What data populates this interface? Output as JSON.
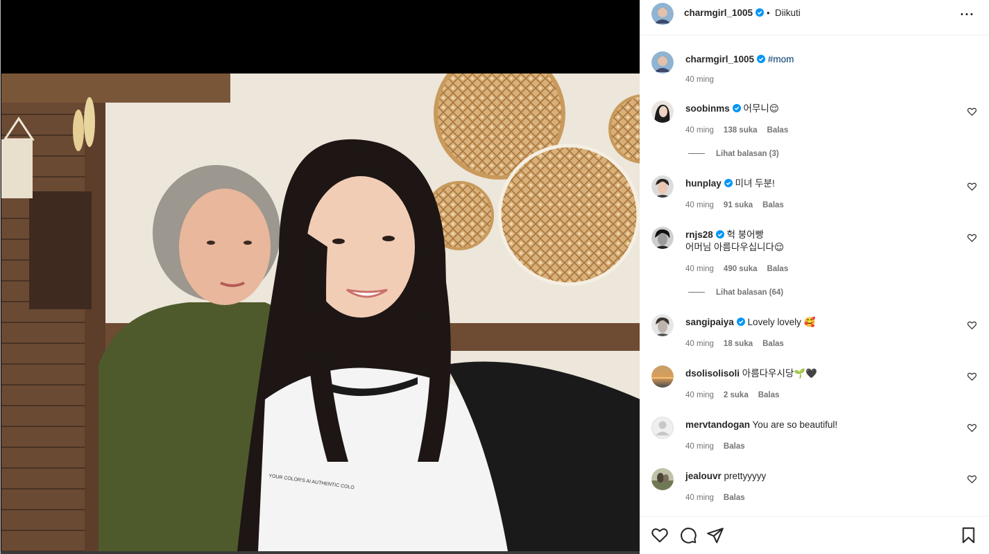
{
  "post": {
    "author": "charmgirl_1005",
    "separator": "•",
    "follow_status": "Diikuti",
    "verified": true
  },
  "caption": {
    "username": "charmgirl_1005",
    "text": "#mom",
    "time": "40 ming"
  },
  "comments": [
    {
      "username": "soobinms",
      "verified": true,
      "text": "어무니😌",
      "time": "40 ming",
      "likes": "138 suka",
      "reply": "Balas",
      "view_replies": "Lihat balasan (3)"
    },
    {
      "username": "hunplay",
      "verified": true,
      "text": "미녀 두분!",
      "time": "40 ming",
      "likes": "91 suka",
      "reply": "Balas"
    },
    {
      "username": "rnjs28",
      "verified": true,
      "text": "헉 붕어빵",
      "text2": "어머님 아름다우십니다😌",
      "time": "40 ming",
      "likes": "490 suka",
      "reply": "Balas",
      "view_replies": "Lihat balasan (64)"
    },
    {
      "username": "sangipaiya",
      "verified": true,
      "text": "Lovely lovely 🥰",
      "time": "40 ming",
      "likes": "18 suka",
      "reply": "Balas"
    },
    {
      "username": "dsolisolisoli",
      "verified": false,
      "text": "아름다우시당🌱🖤",
      "time": "40 ming",
      "likes": "2 suka",
      "reply": "Balas"
    },
    {
      "username": "mervtandogan",
      "verified": false,
      "text": "You are so beautiful!",
      "time": "40 ming",
      "reply": "Balas"
    },
    {
      "username": "jealouvr",
      "verified": false,
      "text": "prettyyyyy",
      "time": "40 ming",
      "reply": "Balas"
    }
  ],
  "photo": {
    "shirt_print": "YOUR COLOR'S AI AUTHENTIC COLO"
  },
  "icons": {
    "like": "heart-icon",
    "comment": "comment-icon",
    "share": "paper-plane-icon",
    "save": "bookmark-icon",
    "more": "more-options-icon",
    "verified": "verified-badge-icon"
  },
  "colors": {
    "verified_blue": "#0095f6",
    "text_primary": "#262626",
    "text_secondary": "#737373",
    "hashtag": "#00376b"
  }
}
